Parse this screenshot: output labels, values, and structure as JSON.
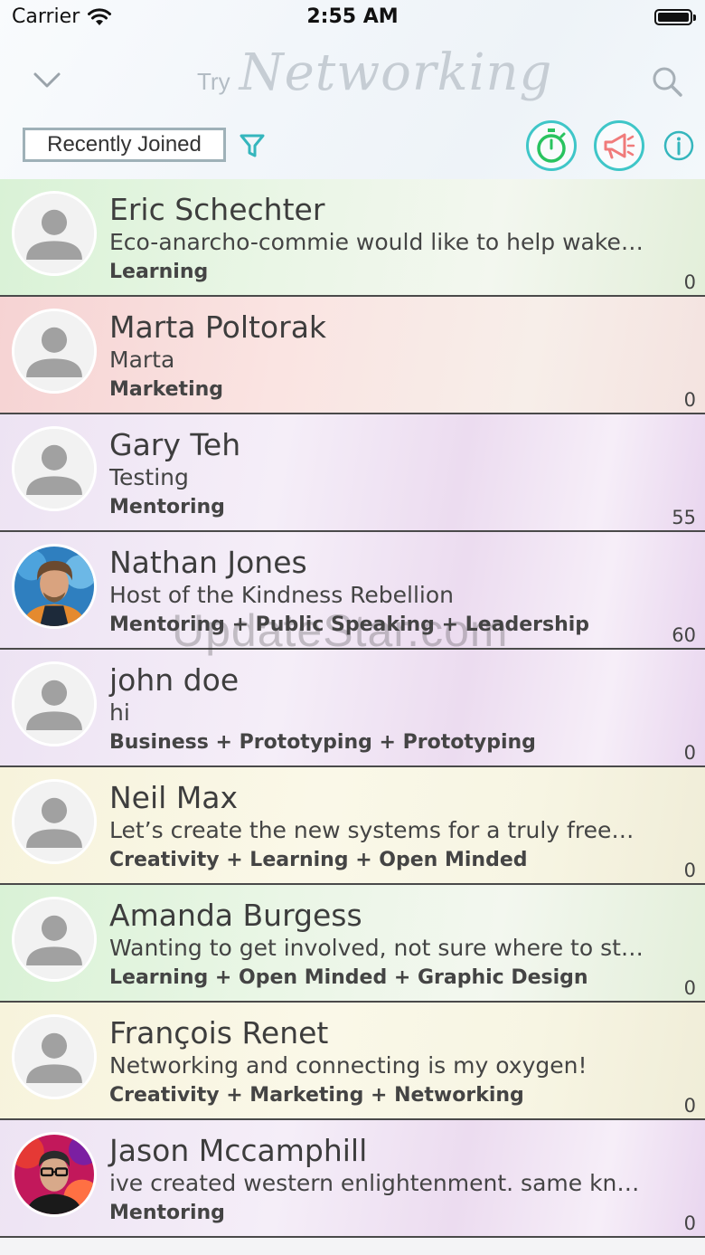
{
  "status_bar": {
    "carrier": "Carrier",
    "time": "2:55 AM"
  },
  "header": {
    "title_prefix": "Try",
    "title": "Networking",
    "sort_label": "Recently Joined"
  },
  "colors": {
    "accent": "#3fc6c8",
    "timer_green": "#29c35f",
    "promo_red": "#f07b7b"
  },
  "icons": [
    "chevron-down-icon",
    "search-icon",
    "filter-icon",
    "stopwatch-icon",
    "megaphone-icon",
    "info-icon",
    "person-icon"
  ],
  "rows": [
    {
      "name": "Eric Schechter",
      "bio": "Eco-anarcho-commie would like to help wake…",
      "tags": "Learning",
      "count": "0",
      "color": "green",
      "avatar": "placeholder"
    },
    {
      "name": "Marta Poltorak",
      "bio": "Marta",
      "tags": "Marketing",
      "count": "0",
      "color": "red",
      "avatar": "placeholder"
    },
    {
      "name": "Gary Teh",
      "bio": "Testing",
      "tags": "Mentoring",
      "count": "55",
      "color": "purple",
      "avatar": "placeholder"
    },
    {
      "name": "Nathan Jones",
      "bio": "Host of the Kindness Rebellion",
      "tags": "Mentoring + Public Speaking + Leadership",
      "count": "60",
      "color": "purple",
      "avatar": "photo-nathan"
    },
    {
      "name": "john doe",
      "bio": "hi",
      "tags": "Business + Prototyping + Prototyping",
      "count": "0",
      "color": "purple",
      "avatar": "placeholder"
    },
    {
      "name": "Neil Max",
      "bio": "Let’s create the new systems for a truly free…",
      "tags": "Creativity + Learning + Open Minded",
      "count": "0",
      "color": "yellow",
      "avatar": "placeholder"
    },
    {
      "name": "Amanda Burgess",
      "bio": "Wanting to get involved, not sure where to st…",
      "tags": "Learning + Open Minded + Graphic Design",
      "count": "0",
      "color": "green",
      "avatar": "placeholder"
    },
    {
      "name": "François Renet",
      "bio": "Networking and connecting is my oxygen!",
      "tags": "Creativity + Marketing + Networking",
      "count": "0",
      "color": "yellow",
      "avatar": "placeholder"
    },
    {
      "name": "Jason Mccamphill",
      "bio": "ive created western enlightenment.  same kn…",
      "tags": "Mentoring",
      "count": "0",
      "color": "purple",
      "avatar": "photo-jason"
    }
  ],
  "watermark": "UpdateStar.com"
}
